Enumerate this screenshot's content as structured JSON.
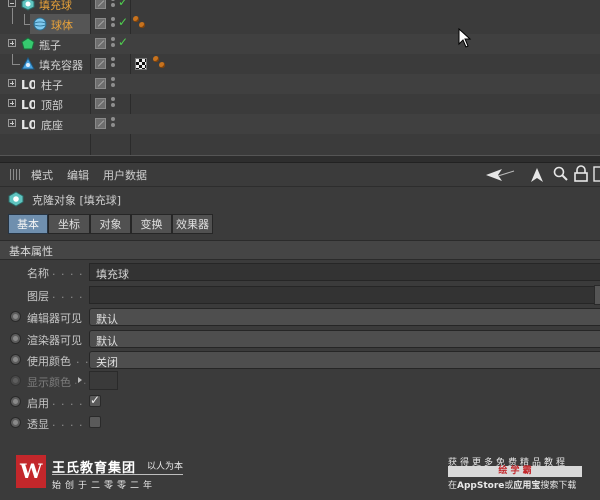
{
  "object_manager": {
    "objects": [
      {
        "name": "填充球",
        "highlight": true,
        "expander": "minus",
        "icon": "cloner-icon",
        "checkmark": "✓"
      },
      {
        "name": "球体",
        "highlight": true,
        "expander": "none",
        "icon": "sphere-icon",
        "checkmark": "✓",
        "tags": [
          "material-tag"
        ]
      },
      {
        "name": "瓶子",
        "highlight": false,
        "expander": "plus",
        "icon": "bottle-icon",
        "checkmark": "✓"
      },
      {
        "name": "填充容器",
        "highlight": false,
        "expander": "none",
        "icon": "container-icon",
        "tags": [
          "checker-material-tag",
          "material-tag"
        ]
      },
      {
        "name": "柱子",
        "highlight": false,
        "expander": "plus",
        "icon": "null-icon"
      },
      {
        "name": "顶部",
        "highlight": false,
        "expander": "plus",
        "icon": "null-icon"
      },
      {
        "name": "底座",
        "highlight": false,
        "expander": "plus",
        "icon": "null-icon"
      }
    ]
  },
  "attribute_manager": {
    "menu": [
      "模式",
      "编辑",
      "用户数据"
    ],
    "title": "克隆对象 [填充球]",
    "tabs": [
      "基本",
      "坐标",
      "对象",
      "变换",
      "效果器"
    ],
    "active_tab": "基本",
    "section_title": "基本属性",
    "properties": {
      "name_label": "名称",
      "name_dots": ". . . . .",
      "name_value": "填充球",
      "layer_label": "图层",
      "layer_dots": ". . . . .",
      "editor_visible_label": "编辑器可见",
      "editor_visible_value": "默认",
      "render_visible_label": "渲染器可见",
      "render_visible_value": "默认",
      "use_color_label": "使用颜色",
      "use_color_dots": ". .",
      "use_color_value": "关闭",
      "display_color_label": "显示颜色",
      "display_color_dots": ". .",
      "enable_label": "启用",
      "enable_dots": ". . . . .",
      "enable_check": "✓",
      "xray_label": "透显",
      "xray_dots": ". . . . ."
    }
  },
  "watermark": {
    "logo_letter": "W",
    "brand_name": "王氏教育集团",
    "slogan": "以人为本",
    "founded": "始创于二零零二年",
    "promo_line1": "获得更多免费精品教程",
    "promo_box": "绘 学 霸",
    "promo_line3_prefix": "在",
    "promo_line3_appstore": "AppStore",
    "promo_line3_or": "或",
    "promo_line3_app": "应用宝",
    "promo_line3_suffix": "搜索下载"
  },
  "colors": {
    "highlight_text": "#e8a23a",
    "check_green": "#4fd04f",
    "active_tab": "#6f8fae",
    "brand_red": "#c3272b"
  }
}
